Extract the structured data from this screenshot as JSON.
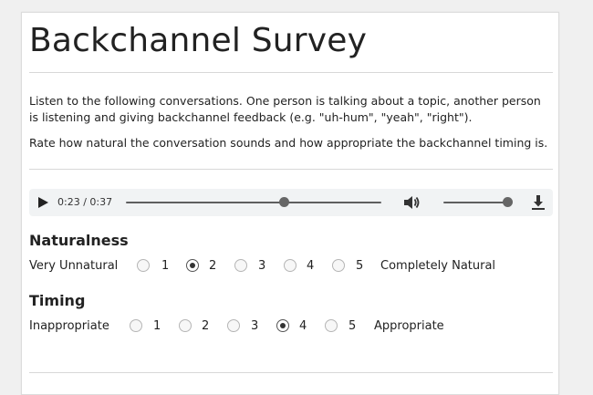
{
  "title": "Backchannel Survey",
  "instructions": {
    "paragraph1": "Listen to the following conversations. One person is talking about a topic, another person is listening and giving backchannel feedback (e.g. \"uh-hum\", \"yeah\", \"right\").",
    "paragraph2": "Rate how natural the conversation sounds and how appropriate the backchannel timing is."
  },
  "audio_player": {
    "time_display": "0:23 / 0:37",
    "playback_progress": 0.62,
    "volume_level": 1.0
  },
  "naturalness": {
    "heading": "Naturalness",
    "low_label": "Very Unnatural",
    "high_label": "Completely Natural",
    "options": [
      "1",
      "2",
      "3",
      "4",
      "5"
    ],
    "selected": "2"
  },
  "timing": {
    "heading": "Timing",
    "low_label": "Inappropriate",
    "high_label": "Appropriate",
    "options": [
      "1",
      "2",
      "3",
      "4",
      "5"
    ],
    "selected": "4"
  },
  "colors": {
    "player_bg": "#f1f3f4",
    "text": "#222222",
    "divider": "#d8d8d8"
  }
}
